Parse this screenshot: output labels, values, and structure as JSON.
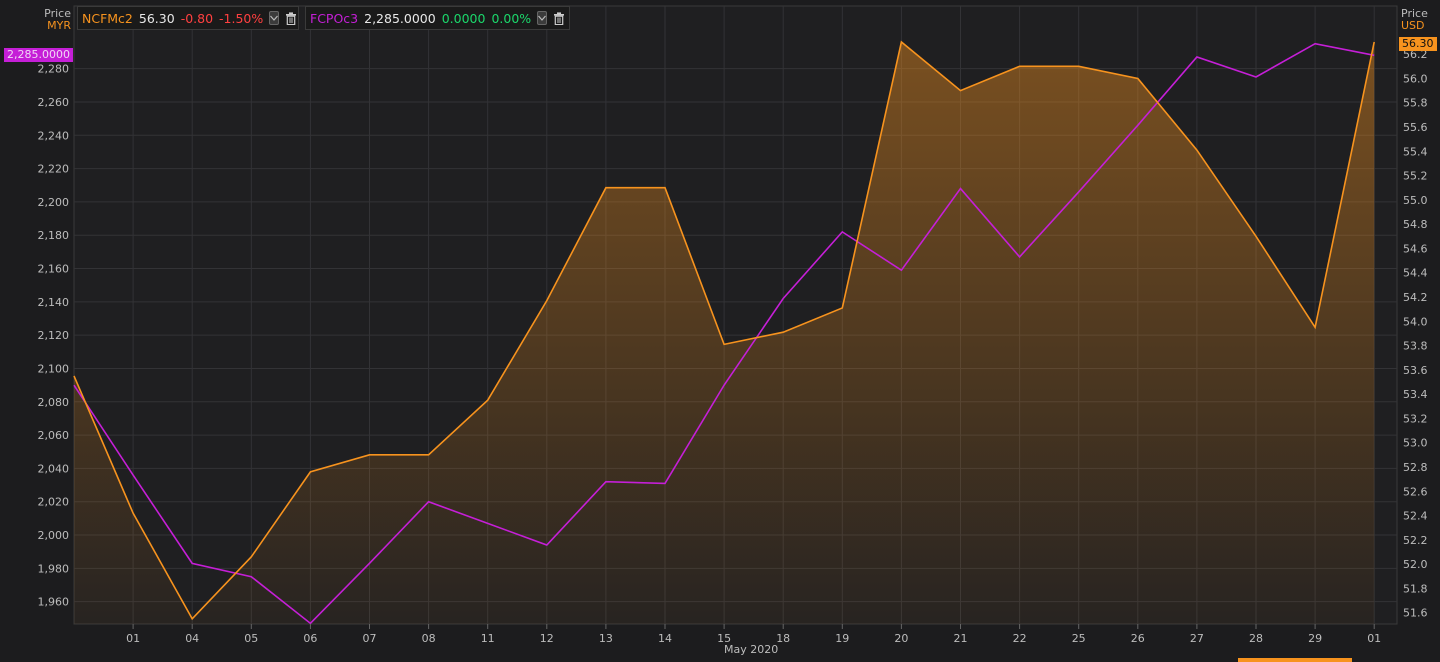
{
  "left_axis": {
    "title": "Price",
    "currency": "MYR"
  },
  "right_axis": {
    "title": "Price",
    "currency": "USD"
  },
  "legend": {
    "series1": {
      "ric": "NCFMc2",
      "last": "56.30",
      "change": "-0.80",
      "pct": "-1.50%"
    },
    "series2": {
      "ric": "FCPOc3",
      "last": "2,285.0000",
      "change": "0.0000",
      "pct": "0.00%"
    }
  },
  "tags": {
    "left": "2,285.0000",
    "right": "56.30"
  },
  "colors": {
    "ncfm": "#f7931e",
    "fcpo": "#c51fd7",
    "negative": "#ff4040",
    "positive": "#1bd76b"
  },
  "chart_data": {
    "type": "line",
    "x_period_label": "May 2020",
    "categories": [
      "",
      "01",
      "04",
      "05",
      "06",
      "07",
      "08",
      "11",
      "12",
      "13",
      "14",
      "15",
      "18",
      "19",
      "20",
      "21",
      "22",
      "25",
      "26",
      "27",
      "28",
      "29",
      "01"
    ],
    "series": [
      {
        "name": "NCFMc2",
        "axis": "right",
        "style": "area",
        "values": [
          53.55,
          52.42,
          51.55,
          52.06,
          52.76,
          52.9,
          52.9,
          53.35,
          54.17,
          55.1,
          55.1,
          53.81,
          53.91,
          54.11,
          56.3,
          55.9,
          56.1,
          56.1,
          56.0,
          55.41,
          54.7,
          53.95,
          56.3
        ]
      },
      {
        "name": "FCPOc3",
        "axis": "left",
        "style": "line",
        "values": [
          2090,
          2036,
          1983,
          1975,
          1947,
          1983,
          2020,
          2007,
          1994,
          2032,
          2031,
          2090,
          2142,
          2182,
          2159,
          2208,
          2167,
          2206,
          2246,
          2287,
          2275,
          2295,
          2288
        ]
      }
    ],
    "left_ticks": [
      "1,960",
      "1,980",
      "2,000",
      "2,020",
      "2,040",
      "2,060",
      "2,080",
      "2,100",
      "2,120",
      "2,140",
      "2,160",
      "2,180",
      "2,200",
      "2,220",
      "2,240",
      "2,260",
      "2,280"
    ],
    "left_tick_values": [
      1960,
      1980,
      2000,
      2020,
      2040,
      2060,
      2080,
      2100,
      2120,
      2140,
      2160,
      2180,
      2200,
      2220,
      2240,
      2260,
      2280
    ],
    "right_ticks": [
      "51.6",
      "51.8",
      "52.0",
      "52.2",
      "52.4",
      "52.6",
      "52.8",
      "53.0",
      "53.2",
      "53.4",
      "53.6",
      "53.8",
      "54.0",
      "54.2",
      "54.4",
      "54.6",
      "54.8",
      "55.0",
      "55.2",
      "55.4",
      "55.6",
      "55.8",
      "56.0",
      "56.2"
    ],
    "right_tick_values": [
      51.6,
      51.8,
      52.0,
      52.2,
      52.4,
      52.6,
      52.8,
      53.0,
      53.2,
      53.4,
      53.6,
      53.8,
      54.0,
      54.2,
      54.4,
      54.6,
      54.8,
      55.0,
      55.2,
      55.4,
      55.6,
      55.8,
      56.0,
      56.2
    ],
    "left_ylim": [
      1949,
      2296
    ],
    "right_ylim": [
      51.54,
      56.3
    ],
    "grid": true
  }
}
